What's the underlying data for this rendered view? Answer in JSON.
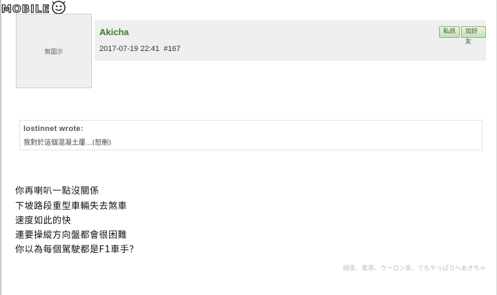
{
  "site": {
    "logo_text": "MOBILE",
    "logo_icon": "smiley-mark-icon"
  },
  "post": {
    "avatar_placeholder": "無圖示",
    "author": "Akicha",
    "datetime": "2017-07-19 22:41",
    "post_number": "#167",
    "buttons": {
      "pm": "私訊",
      "add_friend": "加好友"
    }
  },
  "quote": {
    "author": "lostinnet wrote:",
    "text": "我對於這個混凝土屢...(恕刪)"
  },
  "body_lines": [
    "你再喇叭一點沒關係",
    "下坡路段重型車輛失去煞車",
    "速度如此的快",
    "連要操縱方向盤都會很困難",
    "你以為每個駕駛都是F1車手？"
  ],
  "signature": "緑茶、麦茶、ウーロン茶、でもやっぱりヘあきちゃ",
  "colors": {
    "author": "#3d7a23",
    "header_bg": "#efefef",
    "button_green": "#c6ddbc"
  }
}
